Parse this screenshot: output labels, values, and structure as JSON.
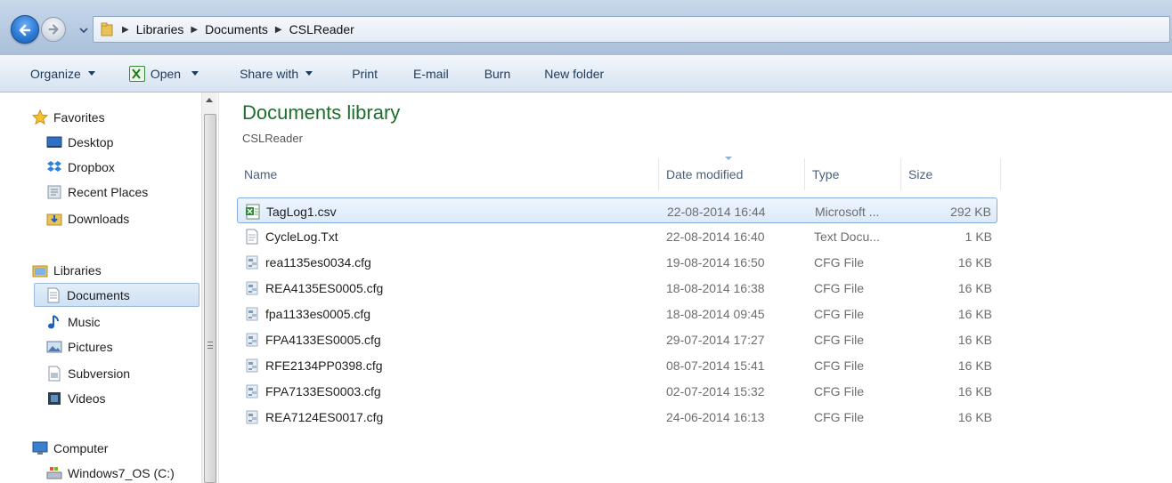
{
  "address": {
    "crumbs": [
      "Libraries",
      "Documents",
      "CSLReader"
    ]
  },
  "toolbar": {
    "organize": "Organize",
    "open": "Open",
    "share_with": "Share with",
    "print": "Print",
    "email": "E-mail",
    "burn": "Burn",
    "new_folder": "New folder"
  },
  "nav": {
    "favorites": "Favorites",
    "desktop": "Desktop",
    "dropbox": "Dropbox",
    "recent_places": "Recent Places",
    "downloads": "Downloads",
    "libraries": "Libraries",
    "documents": "Documents",
    "music": "Music",
    "pictures": "Pictures",
    "subversion": "Subversion",
    "videos": "Videos",
    "computer": "Computer",
    "windows_os": "Windows7_OS (C:)"
  },
  "content": {
    "title": "Documents library",
    "subtitle": "CSLReader",
    "columns": {
      "name": "Name",
      "date": "Date modified",
      "type": "Type",
      "size": "Size"
    },
    "files": [
      {
        "name": "TagLog1.csv",
        "date": "22-08-2014 16:44",
        "type": "Microsoft ...",
        "size": "292 KB",
        "icon": "excel-csv-icon"
      },
      {
        "name": "CycleLog.Txt",
        "date": "22-08-2014 16:40",
        "type": "Text Docu...",
        "size": "1 KB",
        "icon": "text-file-icon"
      },
      {
        "name": "rea1135es0034.cfg",
        "date": "19-08-2014 16:50",
        "type": "CFG File",
        "size": "16 KB",
        "icon": "cfg-file-icon"
      },
      {
        "name": "REA4135ES0005.cfg",
        "date": "18-08-2014 16:38",
        "type": "CFG File",
        "size": "16 KB",
        "icon": "cfg-file-icon"
      },
      {
        "name": "fpa1133es0005.cfg",
        "date": "18-08-2014 09:45",
        "type": "CFG File",
        "size": "16 KB",
        "icon": "cfg-file-icon"
      },
      {
        "name": "FPA4133ES0005.cfg",
        "date": "29-07-2014 17:27",
        "type": "CFG File",
        "size": "16 KB",
        "icon": "cfg-file-icon"
      },
      {
        "name": "RFE2134PP0398.cfg",
        "date": "08-07-2014 15:41",
        "type": "CFG File",
        "size": "16 KB",
        "icon": "cfg-file-icon"
      },
      {
        "name": "FPA7133ES0003.cfg",
        "date": "02-07-2014 15:32",
        "type": "CFG File",
        "size": "16 KB",
        "icon": "cfg-file-icon"
      },
      {
        "name": "REA7124ES0017.cfg",
        "date": "24-06-2014 16:13",
        "type": "CFG File",
        "size": "16 KB",
        "icon": "cfg-file-icon"
      }
    ]
  }
}
